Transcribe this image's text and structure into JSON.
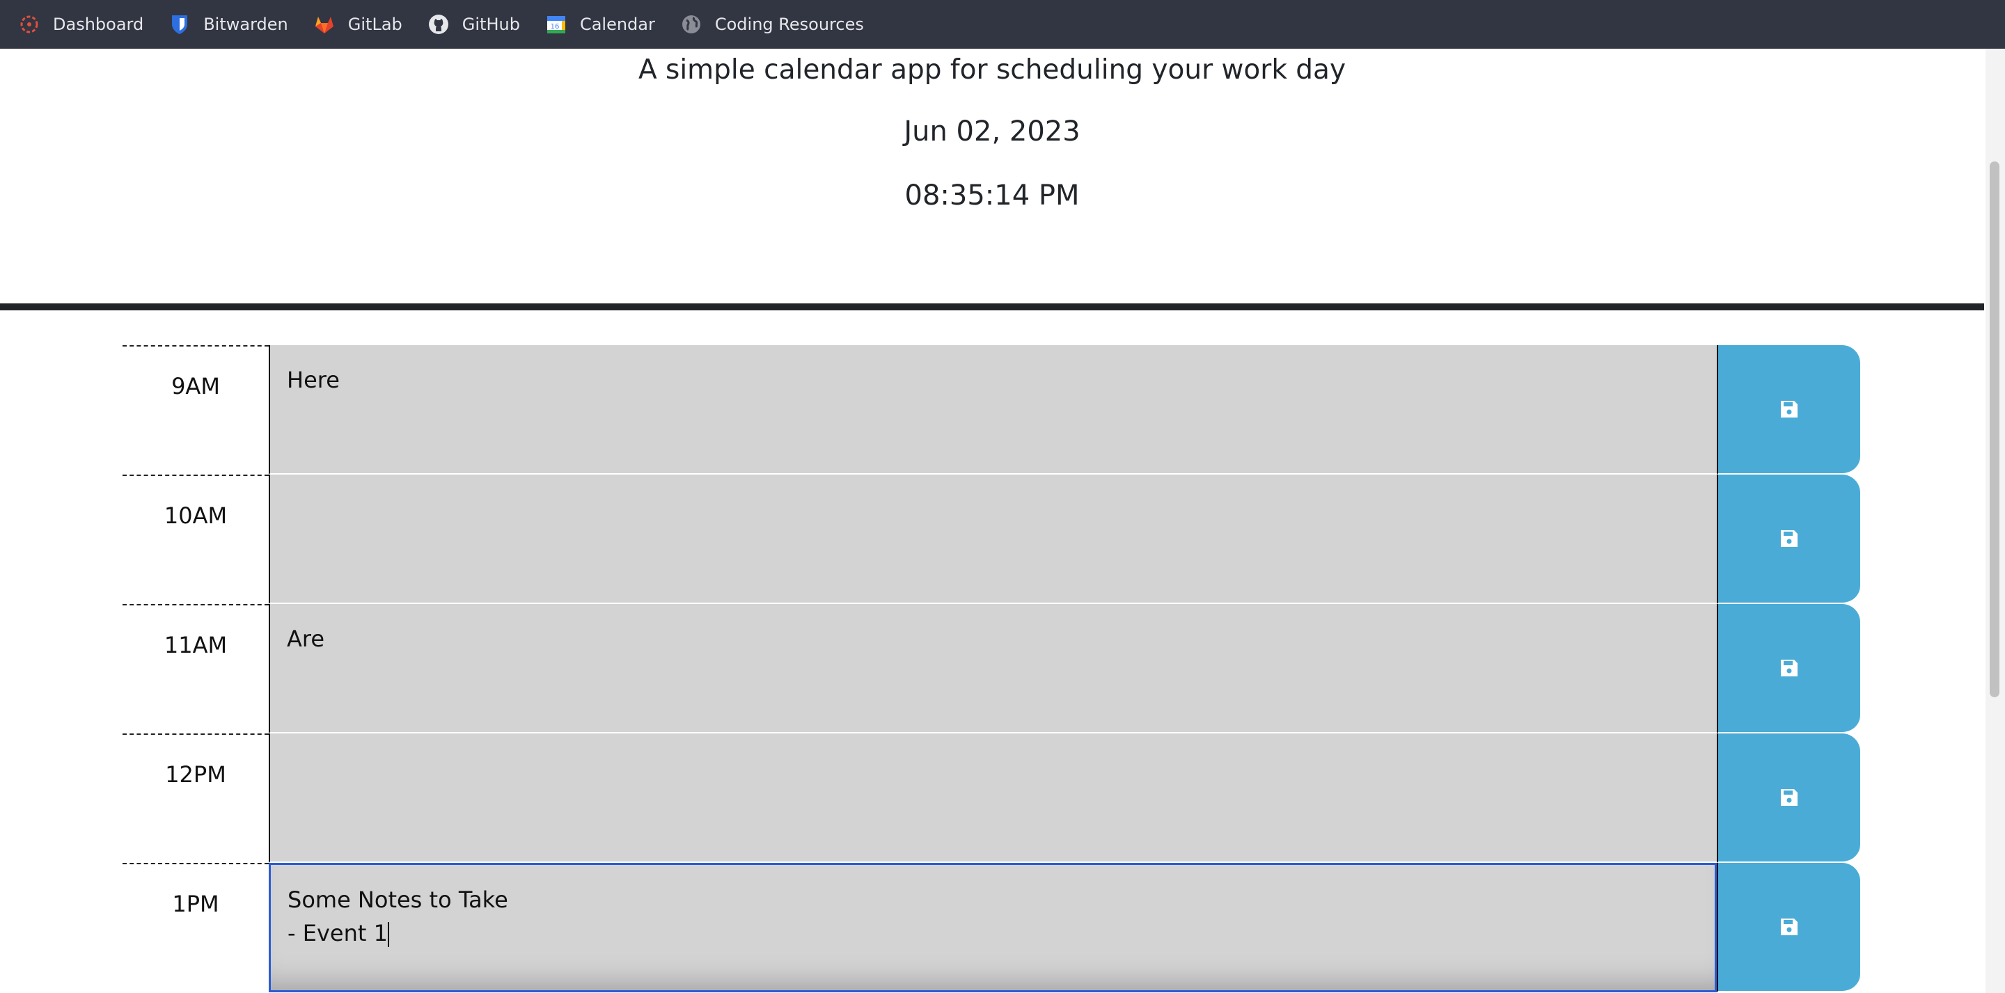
{
  "bookmarks": [
    {
      "label": "Dashboard",
      "icon": "dashboard-icon"
    },
    {
      "label": "Bitwarden",
      "icon": "bitwarden-icon"
    },
    {
      "label": "GitLab",
      "icon": "gitlab-icon"
    },
    {
      "label": "GitHub",
      "icon": "github-icon"
    },
    {
      "label": "Calendar",
      "icon": "calendar-icon"
    },
    {
      "label": "Coding Resources",
      "icon": "globe-icon"
    }
  ],
  "header": {
    "lead": "A simple calendar app for scheduling your work day",
    "date": "Jun 02, 2023",
    "time": "08:35:14 PM"
  },
  "schedule": [
    {
      "hour": "9AM",
      "text": "Here"
    },
    {
      "hour": "10AM",
      "text": ""
    },
    {
      "hour": "11AM",
      "text": "Are"
    },
    {
      "hour": "12PM",
      "text": ""
    },
    {
      "hour": "1PM",
      "text": "Some Notes to Take\n- Event 1"
    }
  ],
  "colors": {
    "bookmark_bar": "#323542",
    "row_background": "#d3d3d3",
    "save_button": "#4aacd6",
    "focus_border": "#2a5bd7"
  }
}
